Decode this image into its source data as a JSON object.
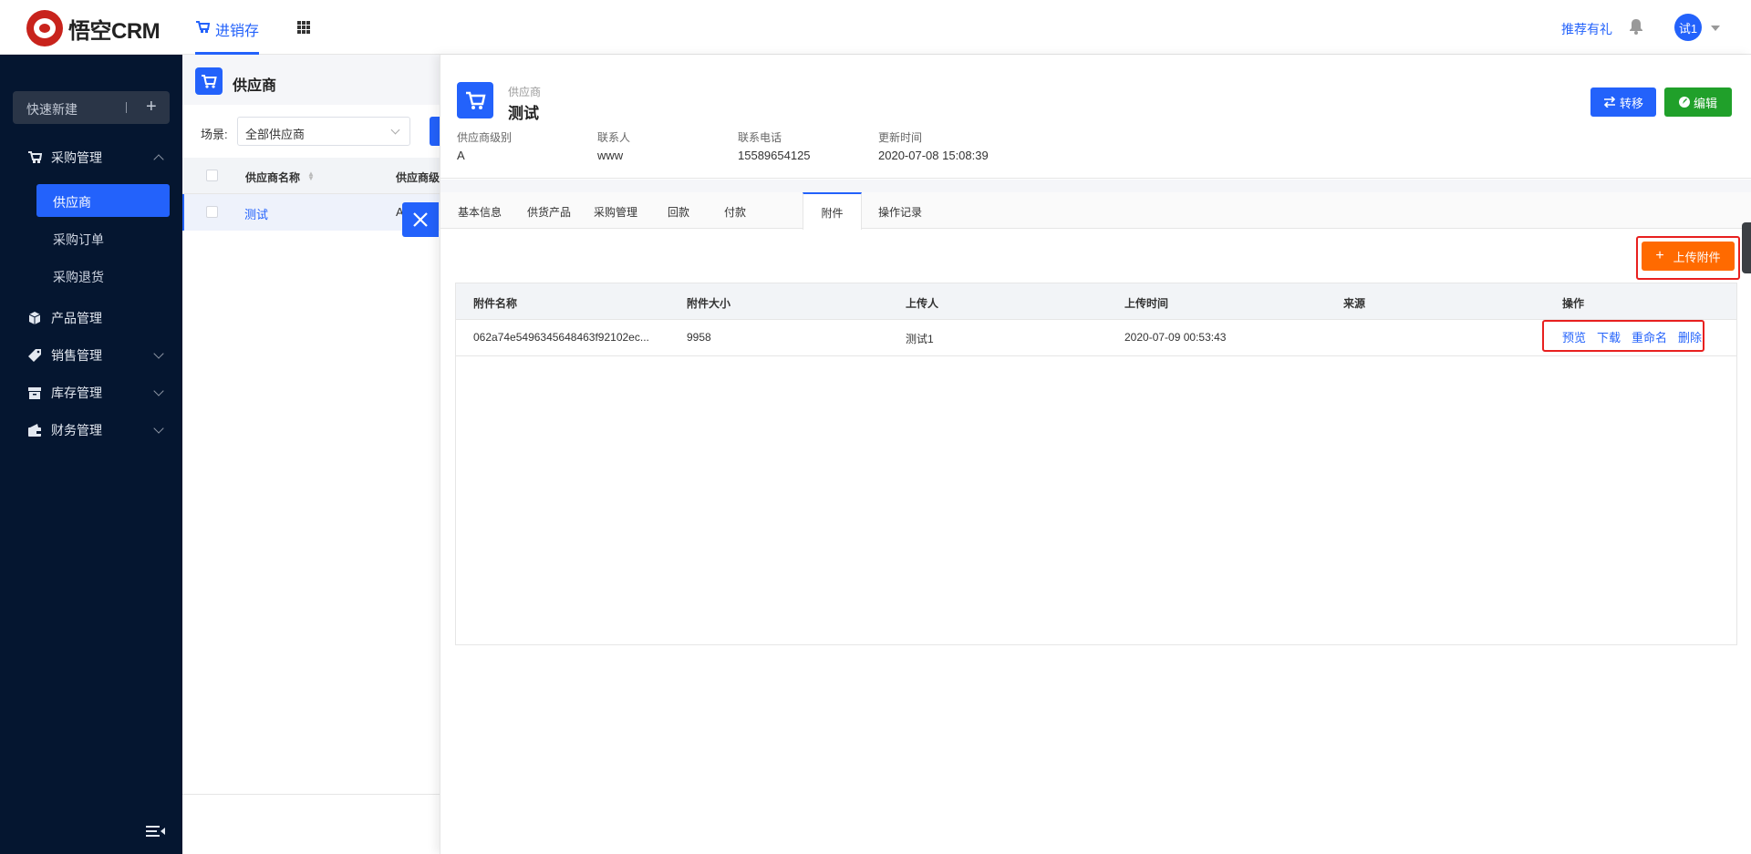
{
  "topbar": {
    "logo_text": "悟空CRM",
    "nav_label": "进销存",
    "recommend": "推荐有礼",
    "avatar_text": "试1"
  },
  "sidebar": {
    "quick_new": "快速新建",
    "menu": {
      "purchase": "采购管理",
      "supplier": "供应商",
      "purchase_order": "采购订单",
      "purchase_return": "采购退货",
      "product": "产品管理",
      "sales": "销售管理",
      "inventory": "库存管理",
      "finance": "财务管理"
    }
  },
  "list": {
    "title": "供应商",
    "scene_label": "场景:",
    "scene_value": "全部供应商",
    "col_name": "供应商名称",
    "col_level": "供应商级",
    "row_name": "测试",
    "row_level": "A"
  },
  "detail": {
    "subtitle": "供应商",
    "title": "测试",
    "transfer_label": "转移",
    "edit_label": "编辑",
    "meta": {
      "level_label": "供应商级别",
      "level_value": "A",
      "contact_label": "联系人",
      "contact_value": "www",
      "phone_label": "联系电话",
      "phone_value": "15589654125",
      "updated_label": "更新时间",
      "updated_value": "2020-07-08 15:08:39"
    },
    "tabs": [
      "基本信息",
      "供货产品",
      "采购管理",
      "回款",
      "付款",
      "附件",
      "操作记录"
    ],
    "upload_label": "上传附件",
    "attachments": {
      "headers": [
        "附件名称",
        "附件大小",
        "上传人",
        "上传时间",
        "来源",
        "操作"
      ],
      "row": {
        "name": "062a74e5496345648463f92102ec...",
        "size": "9958",
        "uploader": "测试1",
        "time": "2020-07-09 00:53:43",
        "source": ""
      },
      "ops": [
        "预览",
        "下载",
        "重命名",
        "删除"
      ]
    }
  },
  "colors": {
    "primary": "#2362fb",
    "success": "#20a02a",
    "warning": "#ff6a00",
    "sidebar_bg": "#051630",
    "highlight_box": "#e8201f"
  }
}
